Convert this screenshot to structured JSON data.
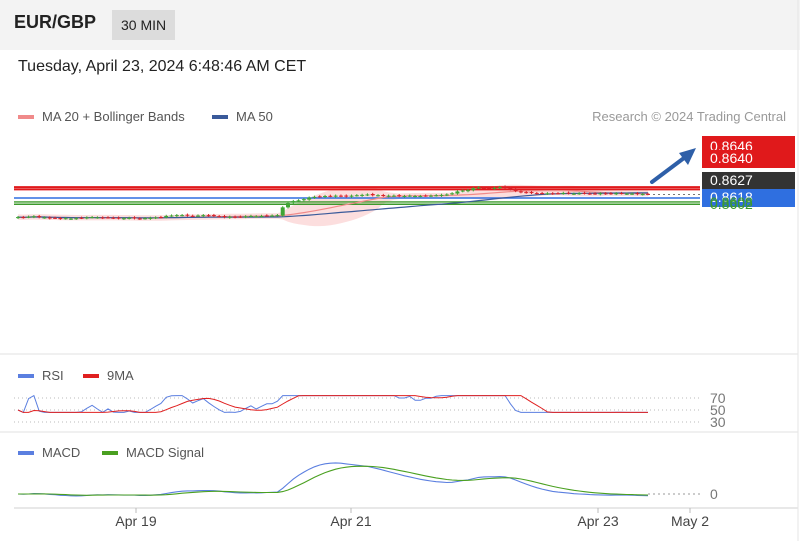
{
  "header": {
    "symbol": "EUR/GBP",
    "timeframe": "30 MIN"
  },
  "timestamp": "Tuesday, April 23, 2024 6:48:46 AM CET",
  "legend": {
    "main": [
      {
        "name": "MA 20 + Bollinger Bands",
        "color": "#f08a8a"
      },
      {
        "name": "MA 50",
        "color": "#3a5a9a"
      }
    ],
    "rsi": [
      {
        "name": "RSI",
        "color": "#5b7fe0"
      },
      {
        "name": "9MA",
        "color": "#e02020"
      }
    ],
    "macd": [
      {
        "name": "MACD",
        "color": "#5b7fe0"
      },
      {
        "name": "MACD Signal",
        "color": "#4aa020"
      }
    ]
  },
  "credit": "Research © 2024 Trading Central",
  "chart_data": {
    "type": "candlestick",
    "x_ticks": [
      "Apr 19",
      "Apr 21",
      "Apr 23",
      "May 2"
    ],
    "price": {
      "levels": [
        {
          "label": "0.8646",
          "value": 0.8646,
          "kind": "resistance",
          "color": "#e0191b"
        },
        {
          "label": "0.8640",
          "value": 0.864,
          "kind": "resistance",
          "color": "#e0191b"
        },
        {
          "label": "0.8627",
          "value": 0.8627,
          "kind": "last",
          "color": "#333333"
        },
        {
          "label": "0.8618",
          "value": 0.8618,
          "kind": "pivot",
          "color": "#2f6fe0"
        },
        {
          "label": "0.8608",
          "value": 0.8608,
          "kind": "support",
          "color": "#3c9a2c"
        },
        {
          "label": "0.8602",
          "value": 0.8602,
          "kind": "support",
          "color": "#3c9a2c"
        }
      ],
      "closes": [
        0.8569,
        0.8568,
        0.857,
        0.8571,
        0.8569,
        0.8568,
        0.8566,
        0.8567,
        0.8565,
        0.8566,
        0.8565,
        0.8566,
        0.8567,
        0.8568,
        0.8569,
        0.8568,
        0.8567,
        0.8568,
        0.8567,
        0.8566,
        0.8566,
        0.8567,
        0.8566,
        0.8565,
        0.8566,
        0.8567,
        0.8568,
        0.8569,
        0.8572,
        0.8573,
        0.8574,
        0.8574,
        0.8573,
        0.8572,
        0.8573,
        0.8574,
        0.8573,
        0.8572,
        0.8571,
        0.8569,
        0.857,
        0.8569,
        0.857,
        0.8571,
        0.8572,
        0.8571,
        0.8572,
        0.8573,
        0.8573,
        0.8574,
        0.8594,
        0.8605,
        0.861,
        0.8612,
        0.8615,
        0.8619,
        0.8621,
        0.8622,
        0.8623,
        0.8623,
        0.8624,
        0.8623,
        0.8622,
        0.8624,
        0.8625,
        0.8626,
        0.8627,
        0.8625,
        0.8625,
        0.8624,
        0.8624,
        0.8624,
        0.8623,
        0.8623,
        0.8624,
        0.8623,
        0.8623,
        0.8624,
        0.8624,
        0.8625,
        0.8626,
        0.8627,
        0.863,
        0.8635,
        0.8637,
        0.8638,
        0.8643,
        0.8645,
        0.8644,
        0.8643,
        0.8644,
        0.8646,
        0.8645,
        0.864,
        0.8636,
        0.8633,
        0.8632,
        0.8631,
        0.863,
        0.863,
        0.863,
        0.8629,
        0.863,
        0.8631,
        0.863,
        0.8629,
        0.863,
        0.863,
        0.8629,
        0.8629,
        0.863,
        0.8629,
        0.8629,
        0.863,
        0.863,
        0.8629,
        0.8629,
        0.8628,
        0.8628,
        0.8628
      ],
      "ylim": [
        0.8545,
        0.866
      ]
    },
    "rsi": {
      "levels": [
        "70",
        "50",
        "30"
      ],
      "ylim": [
        20,
        80
      ]
    },
    "macd": {
      "levels": [
        "0"
      ]
    }
  }
}
